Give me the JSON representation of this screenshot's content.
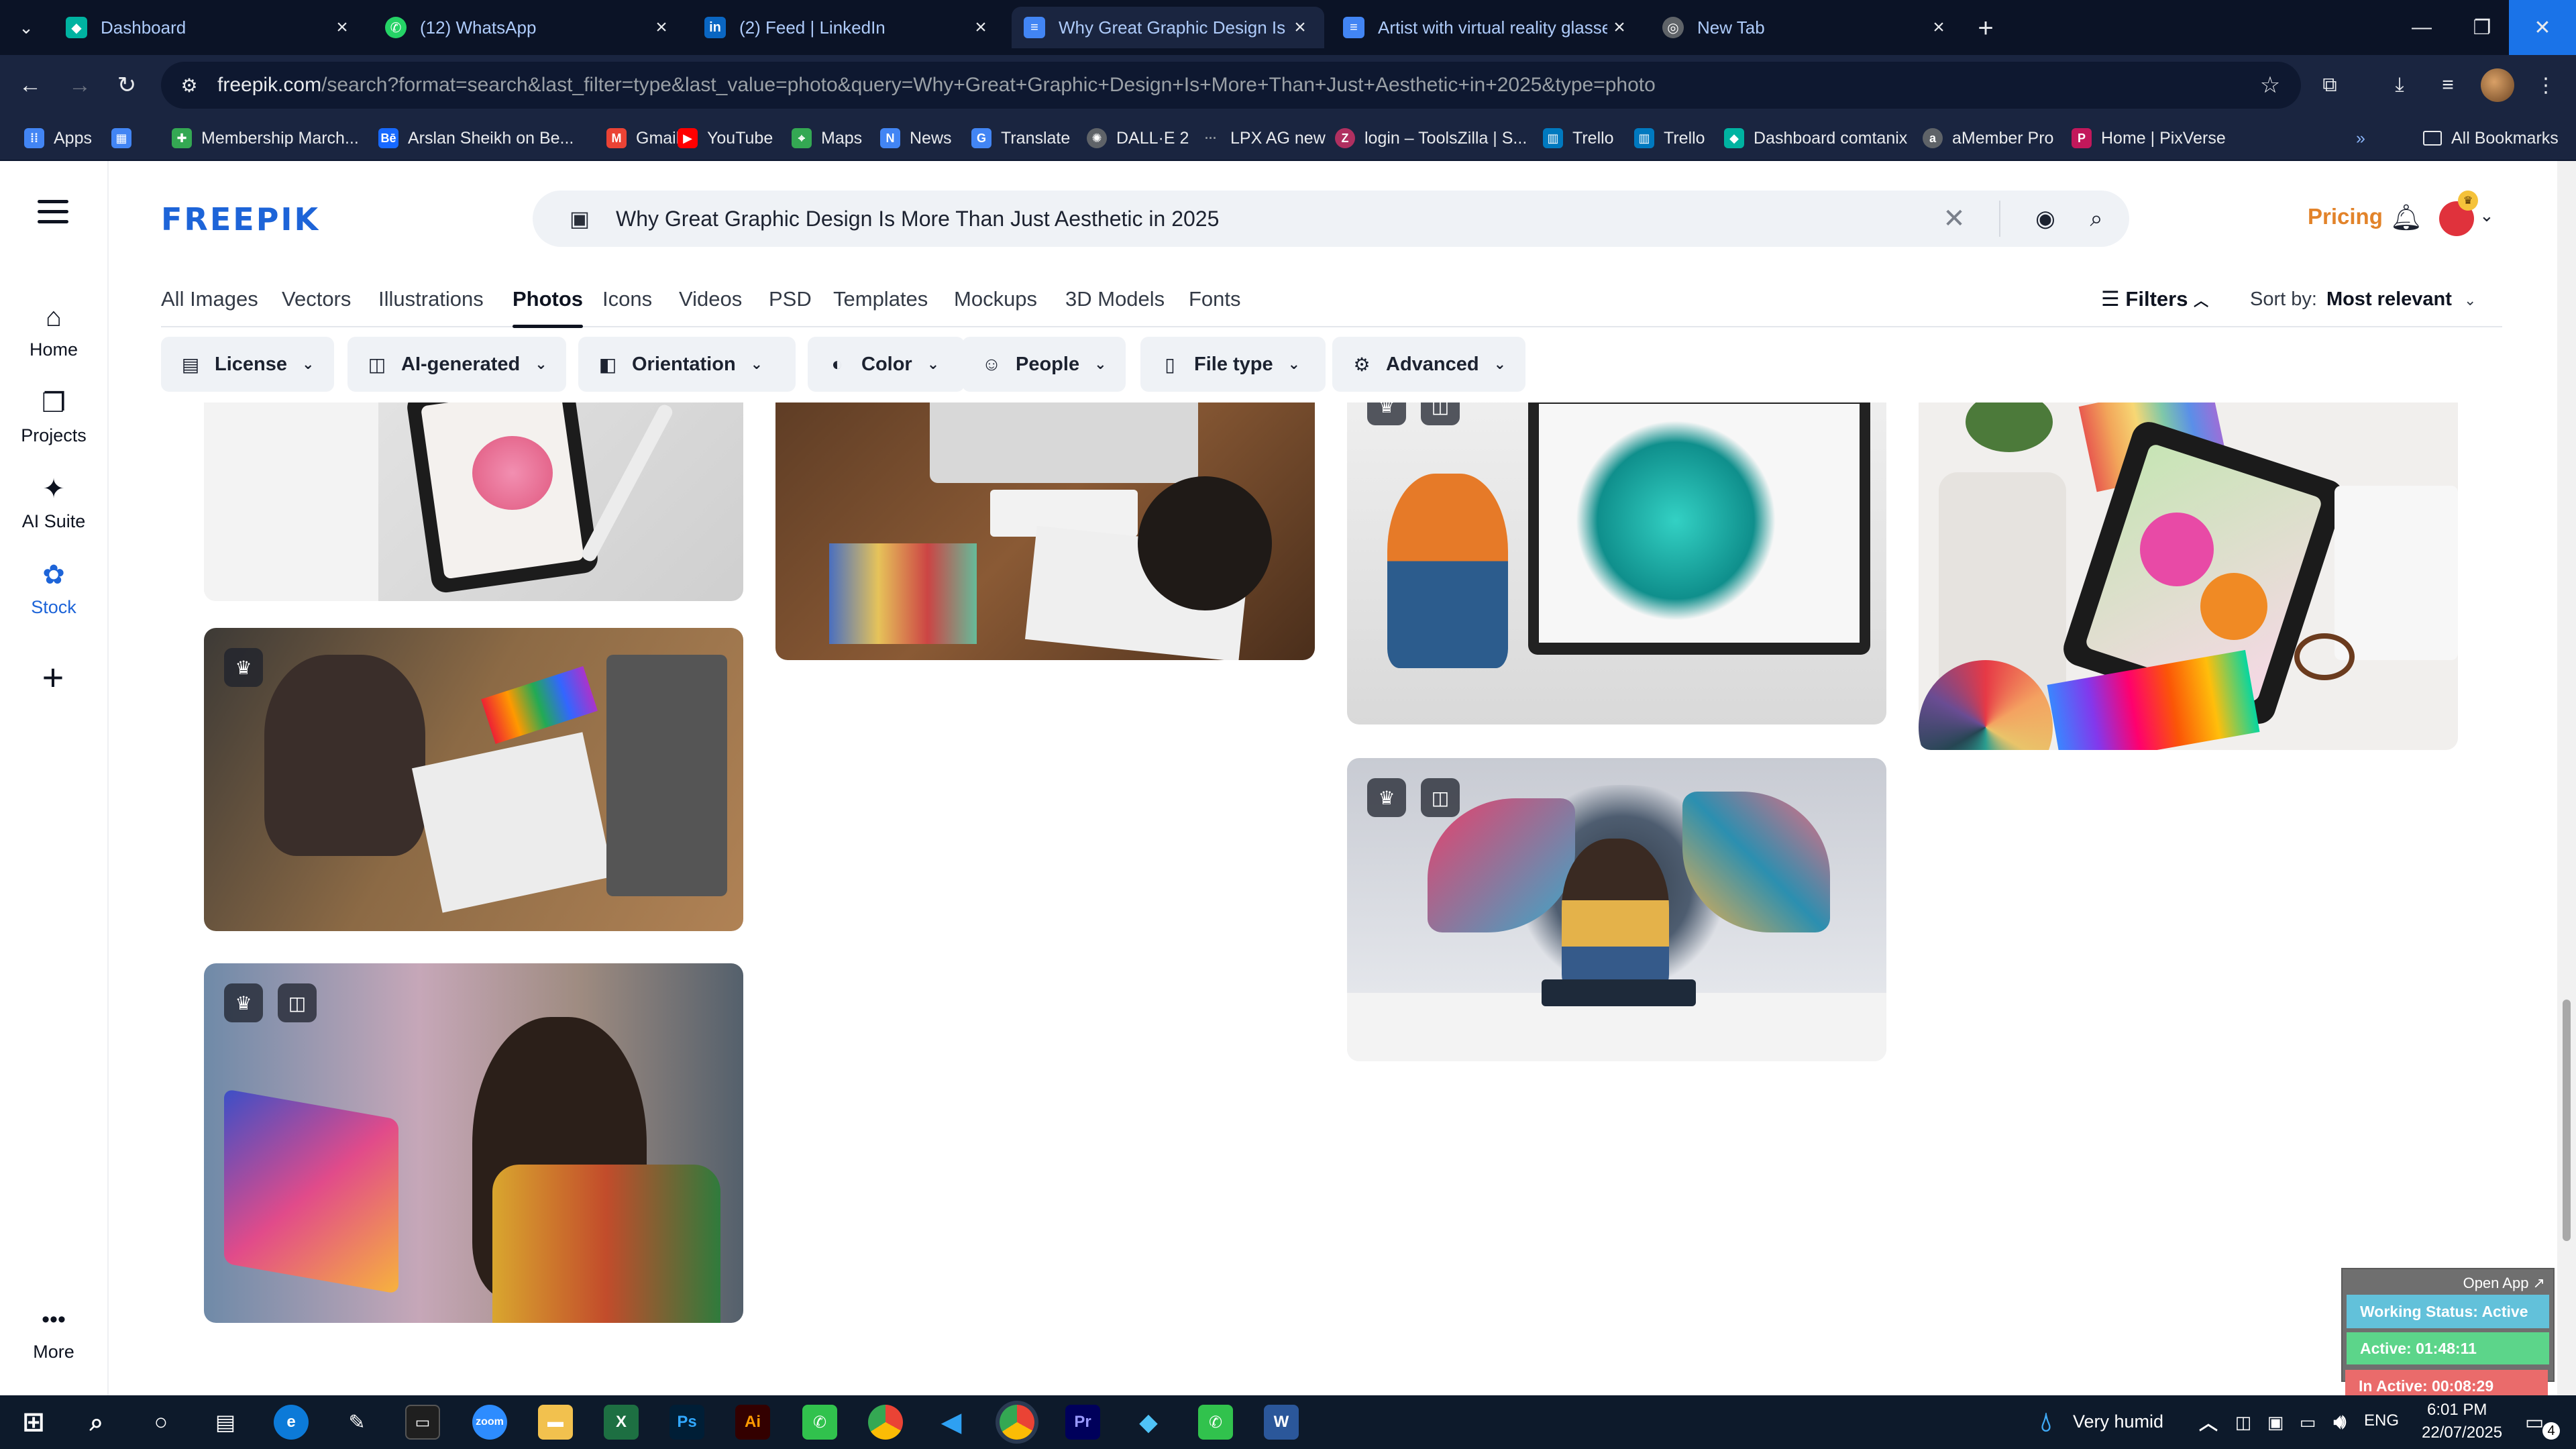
{
  "browser": {
    "tabs": [
      {
        "label": "Dashboard",
        "icon": "diamond-icon",
        "color": "#00b3a1"
      },
      {
        "label": "(12) WhatsApp",
        "icon": "whatsapp-icon",
        "color": "#25d366"
      },
      {
        "label": "(2) Feed | LinkedIn",
        "icon": "linkedin-icon",
        "color": "#0a66c2"
      },
      {
        "label": "Why Great Graphic Design Is M",
        "icon": "docs-icon",
        "color": "#4285f4"
      },
      {
        "label": "Artist with virtual reality glasses",
        "icon": "docs-icon",
        "color": "#4285f4"
      },
      {
        "label": "New Tab",
        "icon": "chrome-icon",
        "color": "#5f6368"
      }
    ],
    "url_host": "freepik.com",
    "url_rest": "/search?format=search&last_filter=type&last_value=photo&query=Why+Great+Graphic+Design+Is+More+Than+Just+Aesthetic+in+2025&type=photo",
    "bookmarks": [
      {
        "label": "Apps",
        "icon": "apps-grid-icon",
        "color": "#4285f4"
      },
      {
        "label": "",
        "icon": "launcher-icon",
        "color": "#4285f4"
      },
      {
        "label": "Membership March...",
        "icon": "membership-icon",
        "color": "#34a853"
      },
      {
        "label": "Arslan Sheikh on Be...",
        "icon": "behance-icon",
        "color": "#1769ff"
      },
      {
        "label": "Gmail",
        "icon": "gmail-icon",
        "color": "#ea4335"
      },
      {
        "label": "YouTube",
        "icon": "youtube-icon",
        "color": "#ff0000"
      },
      {
        "label": "Maps",
        "icon": "maps-icon",
        "color": "#34a853"
      },
      {
        "label": "News",
        "icon": "news-icon",
        "color": "#4285f4"
      },
      {
        "label": "Translate",
        "icon": "translate-icon",
        "color": "#4285f4"
      },
      {
        "label": "DALL·E 2",
        "icon": "openai-icon",
        "color": "#5f6368"
      },
      {
        "label": "LPX AG new",
        "icon": "dots-icon",
        "color": "#5f6368"
      },
      {
        "label": "login – ToolsZilla | S...",
        "icon": "toolszilla-icon",
        "color": "#b03060"
      },
      {
        "label": "Trello",
        "icon": "trello-icon",
        "color": "#0079bf"
      },
      {
        "label": "Trello",
        "icon": "trello-icon",
        "color": "#0079bf"
      },
      {
        "label": "Dashboard comtanix",
        "icon": "diamond-icon",
        "color": "#00b3a1"
      },
      {
        "label": "aMember Pro",
        "icon": "amember-icon",
        "color": "#5f6368"
      },
      {
        "label": "Home | PixVerse",
        "icon": "pixverse-icon",
        "color": "#c2185b"
      }
    ],
    "all_bookmarks": "All Bookmarks"
  },
  "freepik": {
    "logo": "FREEPIK",
    "search_value": "Why Great Graphic Design Is More Than Just Aesthetic in 2025",
    "pricing": "Pricing",
    "rail": [
      {
        "label": "Home",
        "icon": "home-icon"
      },
      {
        "label": "Projects",
        "icon": "projects-icon"
      },
      {
        "label": "AI Suite",
        "icon": "ai-suite-icon"
      },
      {
        "label": "Stock",
        "icon": "stock-icon"
      }
    ],
    "more": "More",
    "categories": [
      "All Images",
      "Vectors",
      "Illustrations",
      "Photos",
      "Icons",
      "Videos",
      "PSD",
      "Templates",
      "Mockups",
      "3D Models",
      "Fonts"
    ],
    "active_category": "Photos",
    "filters_label": "Filters",
    "sort_label": "Sort by:",
    "sort_value": "Most relevant",
    "filter_chips": [
      "License",
      "AI-generated",
      "Orientation",
      "Color",
      "People",
      "File type",
      "Advanced"
    ]
  },
  "work_status": {
    "open_app": "Open App ↗",
    "status": "Working Status: Active",
    "active": "Active: 01:48:11",
    "inactive": "In Active: 00:08:29",
    "colors": {
      "status": "#62c1da",
      "active": "#5cd58a",
      "inactive": "#ea6b6b"
    }
  },
  "taskbar": {
    "weather": "Very humid",
    "lang": "ENG",
    "time": "6:01 PM",
    "date": "22/07/2025",
    "notifications": "4"
  }
}
